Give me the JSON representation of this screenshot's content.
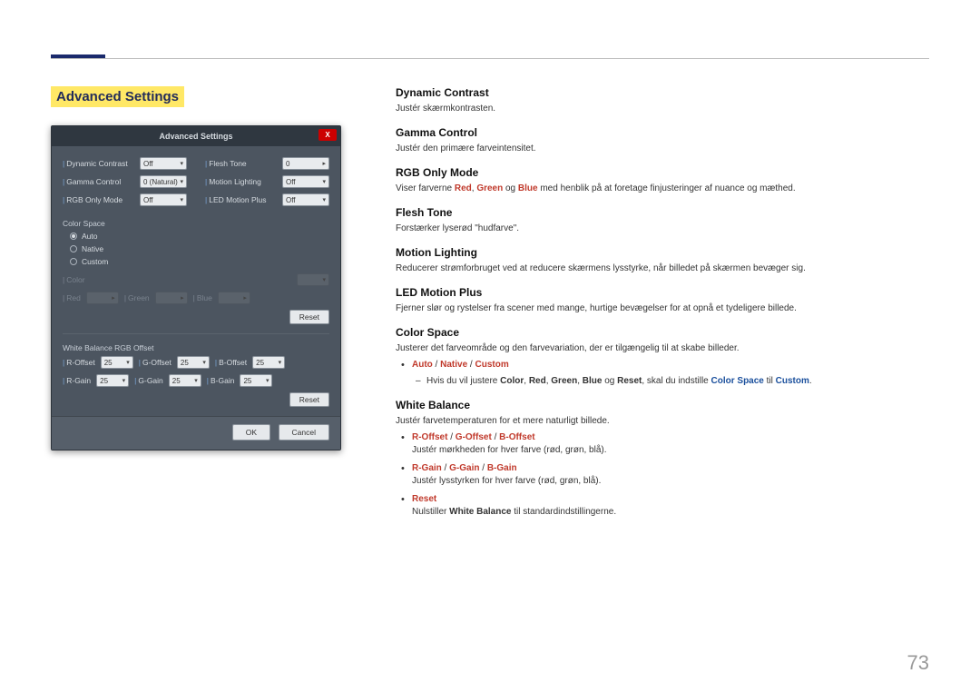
{
  "page_number": "73",
  "section_title": "Advanced Settings",
  "dialog": {
    "title": "Advanced Settings",
    "close": "X",
    "rows_left": [
      {
        "label": "Dynamic Contrast",
        "value": "Off"
      },
      {
        "label": "Gamma Control",
        "value": "0 (Natural)"
      },
      {
        "label": "RGB Only Mode",
        "value": "Off"
      }
    ],
    "rows_right": [
      {
        "label": "Flesh Tone",
        "value": "0"
      },
      {
        "label": "Motion Lighting",
        "value": "Off"
      },
      {
        "label": "LED Motion Plus",
        "value": "Off"
      }
    ],
    "color_space_label": "Color Space",
    "radios": [
      {
        "label": "Auto",
        "checked": true
      },
      {
        "label": "Native",
        "checked": false
      },
      {
        "label": "Custom",
        "checked": false
      }
    ],
    "custom_row": {
      "color_lbl": "Color",
      "color_val": "",
      "red_lbl": "Red",
      "green_lbl": "Green",
      "blue_lbl": "Blue"
    },
    "reset": "Reset",
    "wb_label": "White Balance RGB Offset",
    "wb_row1": [
      {
        "label": "R-Offset",
        "value": "25"
      },
      {
        "label": "G-Offset",
        "value": "25"
      },
      {
        "label": "B-Offset",
        "value": "25"
      }
    ],
    "wb_row2": [
      {
        "label": "R-Gain",
        "value": "25"
      },
      {
        "label": "G-Gain",
        "value": "25"
      },
      {
        "label": "B-Gain",
        "value": "25"
      }
    ],
    "ok": "OK",
    "cancel": "Cancel"
  },
  "content": {
    "dynamic_contrast": {
      "h": "Dynamic Contrast",
      "p": "Justér skærmkontrasten."
    },
    "gamma_control": {
      "h": "Gamma Control",
      "p": "Justér den primære farveintensitet."
    },
    "rgb_only_mode": {
      "h": "RGB Only Mode",
      "p_pre": "Viser farverne ",
      "red": "Red",
      "comma1": ", ",
      "green": "Green",
      "og1": " og ",
      "blue": "Blue",
      "p_post": " med henblik på at foretage finjusteringer af nuance og mæthed."
    },
    "flesh_tone": {
      "h": "Flesh Tone",
      "p": "Forstærker lyserød \"hudfarve\"."
    },
    "motion_lighting": {
      "h": "Motion Lighting",
      "p": "Reducerer strømforbruget ved at reducere skærmens lysstyrke, når billedet på skærmen bevæger sig."
    },
    "led_motion_plus": {
      "h": "LED Motion Plus",
      "p": "Fjerner slør og rystelser fra scener med mange, hurtige bevægelser for at opnå et tydeligere billede."
    },
    "color_space": {
      "h": "Color Space",
      "p": "Justerer det farveområde og den farvevariation, der er tilgængelig til at skabe billeder.",
      "li1": {
        "auto": "Auto",
        "slash1": " / ",
        "native": "Native",
        "slash2": " / ",
        "custom": "Custom"
      },
      "dash_pre": "Hvis du vil justere ",
      "color": "Color",
      "c1": ", ",
      "red": "Red",
      "c2": ", ",
      "green": "Green",
      "c3": ", ",
      "blue": "Blue",
      "og": " og ",
      "reset": "Reset",
      "mid": ", skal du indstille ",
      "cs": "Color Space",
      "til": " til ",
      "custom": "Custom",
      "dot": "."
    },
    "white_balance": {
      "h": "White Balance",
      "p": "Justér farvetemperaturen for et mere naturligt billede.",
      "li_offset": {
        "r": "R-Offset",
        "s1": " / ",
        "g": "G-Offset",
        "s2": " / ",
        "b": "B-Offset",
        "desc": "Justér mørkheden for hver farve (rød, grøn, blå)."
      },
      "li_gain": {
        "r": "R-Gain",
        "s1": " / ",
        "g": "G-Gain",
        "s2": " / ",
        "b": "B-Gain",
        "desc": "Justér lysstyrken for hver farve (rød, grøn, blå)."
      },
      "li_reset": {
        "label": "Reset",
        "desc_pre": "Nulstiller ",
        "wb": "White Balance",
        "desc_post": " til standardindstillingerne."
      }
    }
  }
}
